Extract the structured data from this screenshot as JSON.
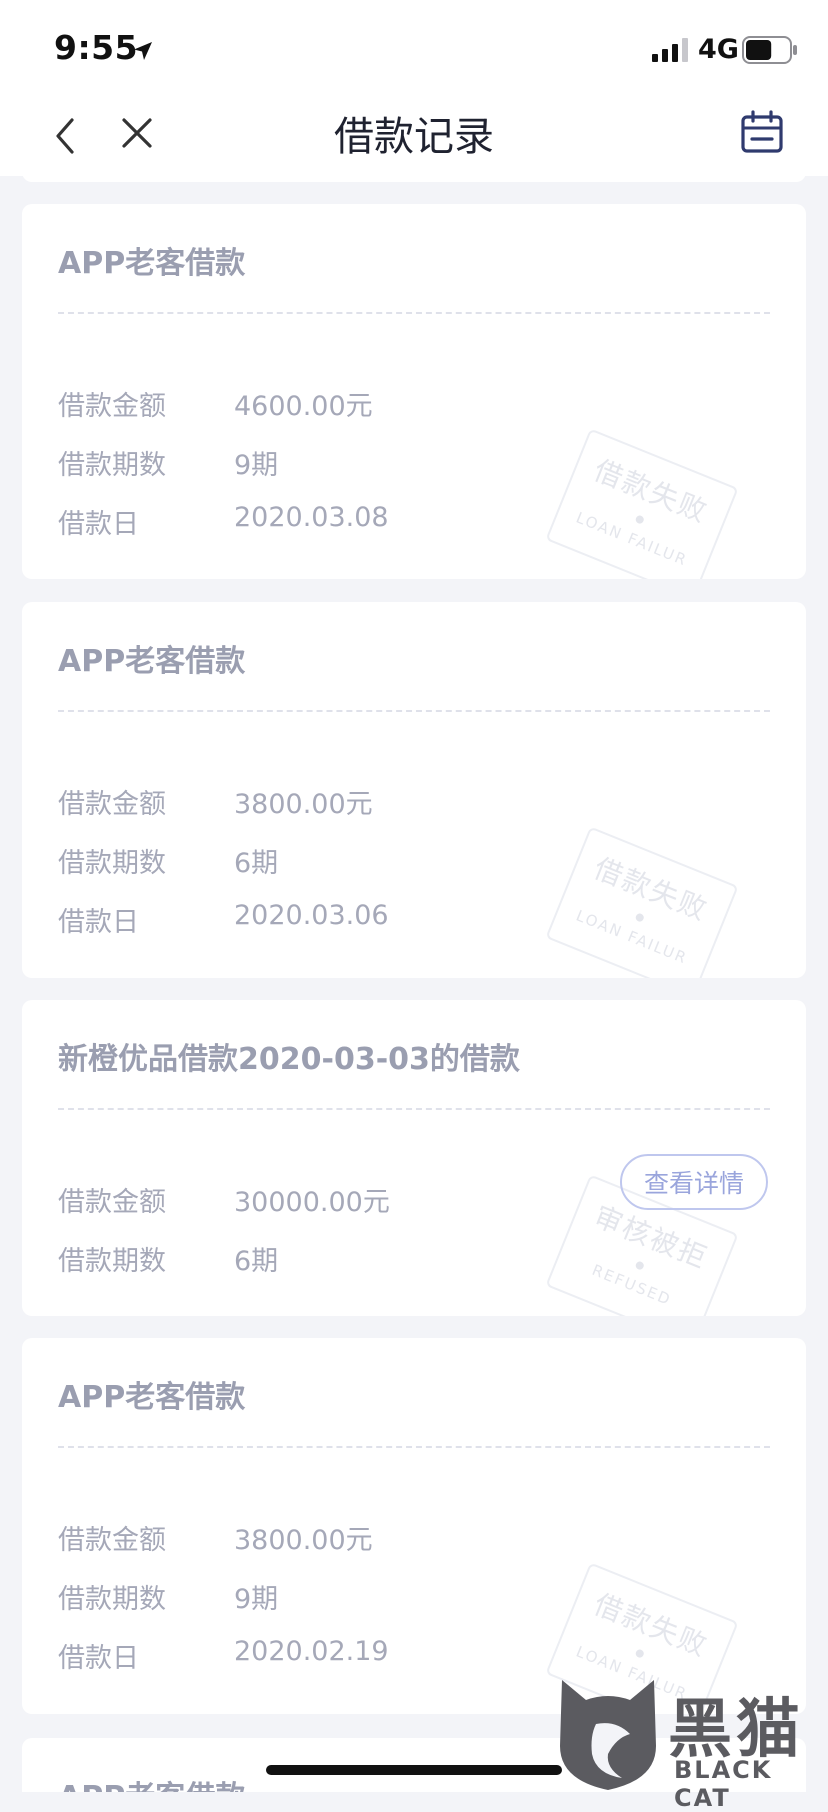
{
  "status": {
    "time": "9:55",
    "network": "4G",
    "battery_level": 0.6
  },
  "nav": {
    "title": "借款记录"
  },
  "icons": [
    "location-arrow-icon",
    "signal-icon",
    "battery-icon",
    "back-icon",
    "close-icon",
    "calendar-icon"
  ],
  "records": [
    {
      "title": "APP老客借款",
      "rows": [
        {
          "label": "借款金额",
          "value": "4600.00元"
        },
        {
          "label": "借款期数",
          "value": "9期"
        },
        {
          "label": "借款日",
          "value": "2020.03.08"
        }
      ],
      "stamp": {
        "text": "借款失败",
        "subtext": "LOAN FAILUR"
      }
    },
    {
      "title": "APP老客借款",
      "rows": [
        {
          "label": "借款金额",
          "value": "3800.00元"
        },
        {
          "label": "借款期数",
          "value": "6期"
        },
        {
          "label": "借款日",
          "value": "2020.03.06"
        }
      ],
      "stamp": {
        "text": "借款失败",
        "subtext": "LOAN FAILUR"
      }
    },
    {
      "title": "新橙优品借款2020-03-03的借款",
      "rows": [
        {
          "label": "借款金额",
          "value": "30000.00元"
        },
        {
          "label": "借款期数",
          "value": "6期"
        }
      ],
      "stamp": {
        "text": "审核被拒",
        "subtext": "REFUSED"
      },
      "detail_button": "查看详情"
    },
    {
      "title": "APP老客借款",
      "rows": [
        {
          "label": "借款金额",
          "value": "3800.00元"
        },
        {
          "label": "借款期数",
          "value": "9期"
        },
        {
          "label": "借款日",
          "value": "2020.02.19"
        }
      ],
      "stamp": {
        "text": "借款失败",
        "subtext": "LOAN FAILUR"
      }
    },
    {
      "title": "APP老客借款"
    }
  ],
  "watermark": {
    "text": "黑猫",
    "subtext": "BLACK CAT"
  },
  "colors": {
    "background": "#f3f4f8",
    "card": "#ffffff",
    "text_muted": "#a5a8b8",
    "accent": "#9aa5dc"
  }
}
